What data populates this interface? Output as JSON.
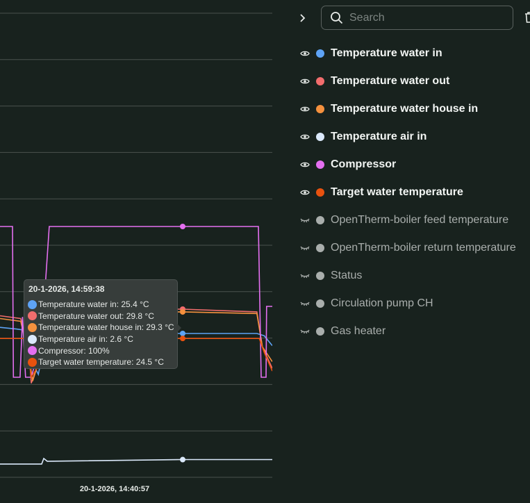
{
  "chart_data": {
    "type": "line",
    "xlabel_tick": "20-1-2026, 14:40:57",
    "x_range": [
      "14:09:29",
      "15:24:14"
    ],
    "temp_ylim": [
      -0.6,
      83.3
    ],
    "percent_ylim": [
      0,
      100
    ],
    "grid": true,
    "hover_time": "14:59:38",
    "series": [
      {
        "name": "Temperature water in",
        "color": "#5ea3f5",
        "axis": "temp",
        "points": [
          [
            "14:09:29",
            26.5
          ],
          [
            "14:14:00",
            26.2
          ],
          [
            "14:17:06",
            25.9
          ],
          [
            "14:18:30",
            20
          ],
          [
            "14:20:00",
            18
          ],
          [
            "14:21:30",
            23
          ],
          [
            "14:23:47",
            25.4
          ],
          [
            "14:59:38",
            25.4
          ],
          [
            "15:20:00",
            25.4
          ],
          [
            "15:22:00",
            25.0
          ],
          [
            "15:24:14",
            23.2
          ]
        ]
      },
      {
        "name": "Temperature water out",
        "color": "#f26d6d",
        "axis": "temp",
        "points": [
          [
            "14:09:29",
            28.6
          ],
          [
            "14:15:10",
            28.1
          ],
          [
            "14:17:30",
            22
          ],
          [
            "14:18:04",
            16.4
          ],
          [
            "14:19:30",
            19
          ],
          [
            "14:21:00",
            27
          ],
          [
            "14:23:47",
            29.8
          ],
          [
            "14:59:38",
            29.8
          ],
          [
            "15:20:00",
            29.3
          ],
          [
            "15:21:30",
            23
          ],
          [
            "15:24:14",
            19.1
          ]
        ]
      },
      {
        "name": "Temperature water house in",
        "color": "#f5913e",
        "axis": "temp",
        "points": [
          [
            "14:09:29",
            28.1
          ],
          [
            "14:15:10",
            27.6
          ],
          [
            "14:17:30",
            21
          ],
          [
            "14:18:27",
            16.8
          ],
          [
            "14:19:30",
            19
          ],
          [
            "14:21:00",
            26.5
          ],
          [
            "14:23:47",
            29.3
          ],
          [
            "14:59:38",
            29.3
          ],
          [
            "15:20:00",
            29.0
          ],
          [
            "15:21:30",
            23
          ],
          [
            "15:24:14",
            20.3
          ]
        ]
      },
      {
        "name": "Temperature air in",
        "color": "#dbe9fb",
        "axis": "temp",
        "points": [
          [
            "14:09:29",
            1.8
          ],
          [
            "14:20:55",
            1.8
          ],
          [
            "14:21:30",
            2.8
          ],
          [
            "14:22:27",
            2.3
          ],
          [
            "14:59:38",
            2.6
          ],
          [
            "15:24:14",
            2.6
          ]
        ]
      },
      {
        "name": "Compressor",
        "color": "#e46ff0",
        "unit": "%",
        "axis": "percent",
        "points": [
          [
            "14:09:29",
            100
          ],
          [
            "14:12:55",
            100
          ],
          [
            "14:13:10",
            0
          ],
          [
            "14:15:00",
            0
          ],
          [
            "14:15:40",
            40
          ],
          [
            "14:16:30",
            0
          ],
          [
            "14:18:04",
            0
          ],
          [
            "14:20:55",
            25
          ],
          [
            "14:22:27",
            80
          ],
          [
            "14:23:00",
            100
          ],
          [
            "14:59:38",
            100
          ],
          [
            "15:20:25",
            100
          ],
          [
            "15:21:11",
            0
          ],
          [
            "15:22:31",
            0
          ],
          [
            "15:22:40",
            47
          ],
          [
            "15:24:14",
            47
          ]
        ]
      },
      {
        "name": "Target water temperature",
        "color": "#e8520f",
        "axis": "temp",
        "points": [
          [
            "14:09:29",
            24.5
          ],
          [
            "14:16:40",
            24.5
          ],
          [
            "14:18:04",
            17.5
          ],
          [
            "14:19:30",
            19
          ],
          [
            "14:21:00",
            24.5
          ],
          [
            "14:59:38",
            24.5
          ],
          [
            "15:20:40",
            24.5
          ],
          [
            "15:22:00",
            22
          ],
          [
            "15:24:14",
            18.6
          ]
        ]
      }
    ]
  },
  "tooltip": {
    "timestamp": "20-1-2026, 14:59:38",
    "rows": [
      {
        "label": "Temperature water in: 25.4 °C",
        "color": "#5ea3f5"
      },
      {
        "label": "Temperature water out: 29.8 °C",
        "color": "#f26d6d"
      },
      {
        "label": "Temperature water house in: 29.3 °C",
        "color": "#f5913e"
      },
      {
        "label": "Temperature air in: 2.6 °C",
        "color": "#dbe9fb"
      },
      {
        "label": "Compressor: 100%",
        "color": "#e46ff0"
      },
      {
        "label": "Target water temperature: 24.5 °C",
        "color": "#e8520f"
      }
    ]
  },
  "search": {
    "placeholder": "Search",
    "value": ""
  },
  "legend": [
    {
      "label": "Temperature water in",
      "color": "#5ea3f5",
      "visible": true
    },
    {
      "label": "Temperature water out",
      "color": "#f26d6d",
      "visible": true
    },
    {
      "label": "Temperature water house in",
      "color": "#f5913e",
      "visible": true
    },
    {
      "label": "Temperature air in",
      "color": "#dbe9fb",
      "visible": true
    },
    {
      "label": "Compressor",
      "color": "#e46ff0",
      "visible": true
    },
    {
      "label": "Target water temperature",
      "color": "#e8520f",
      "visible": true
    },
    {
      "label": "OpenTherm-boiler feed temperature",
      "color": "#a9aeac",
      "visible": false
    },
    {
      "label": "OpenTherm-boiler return temperature",
      "color": "#a9aeac",
      "visible": false
    },
    {
      "label": "Status",
      "color": "#a9aeac",
      "visible": false
    },
    {
      "label": "Circulation pump CH",
      "color": "#a9aeac",
      "visible": false
    },
    {
      "label": "Gas heater",
      "color": "#a9aeac",
      "visible": false
    }
  ]
}
